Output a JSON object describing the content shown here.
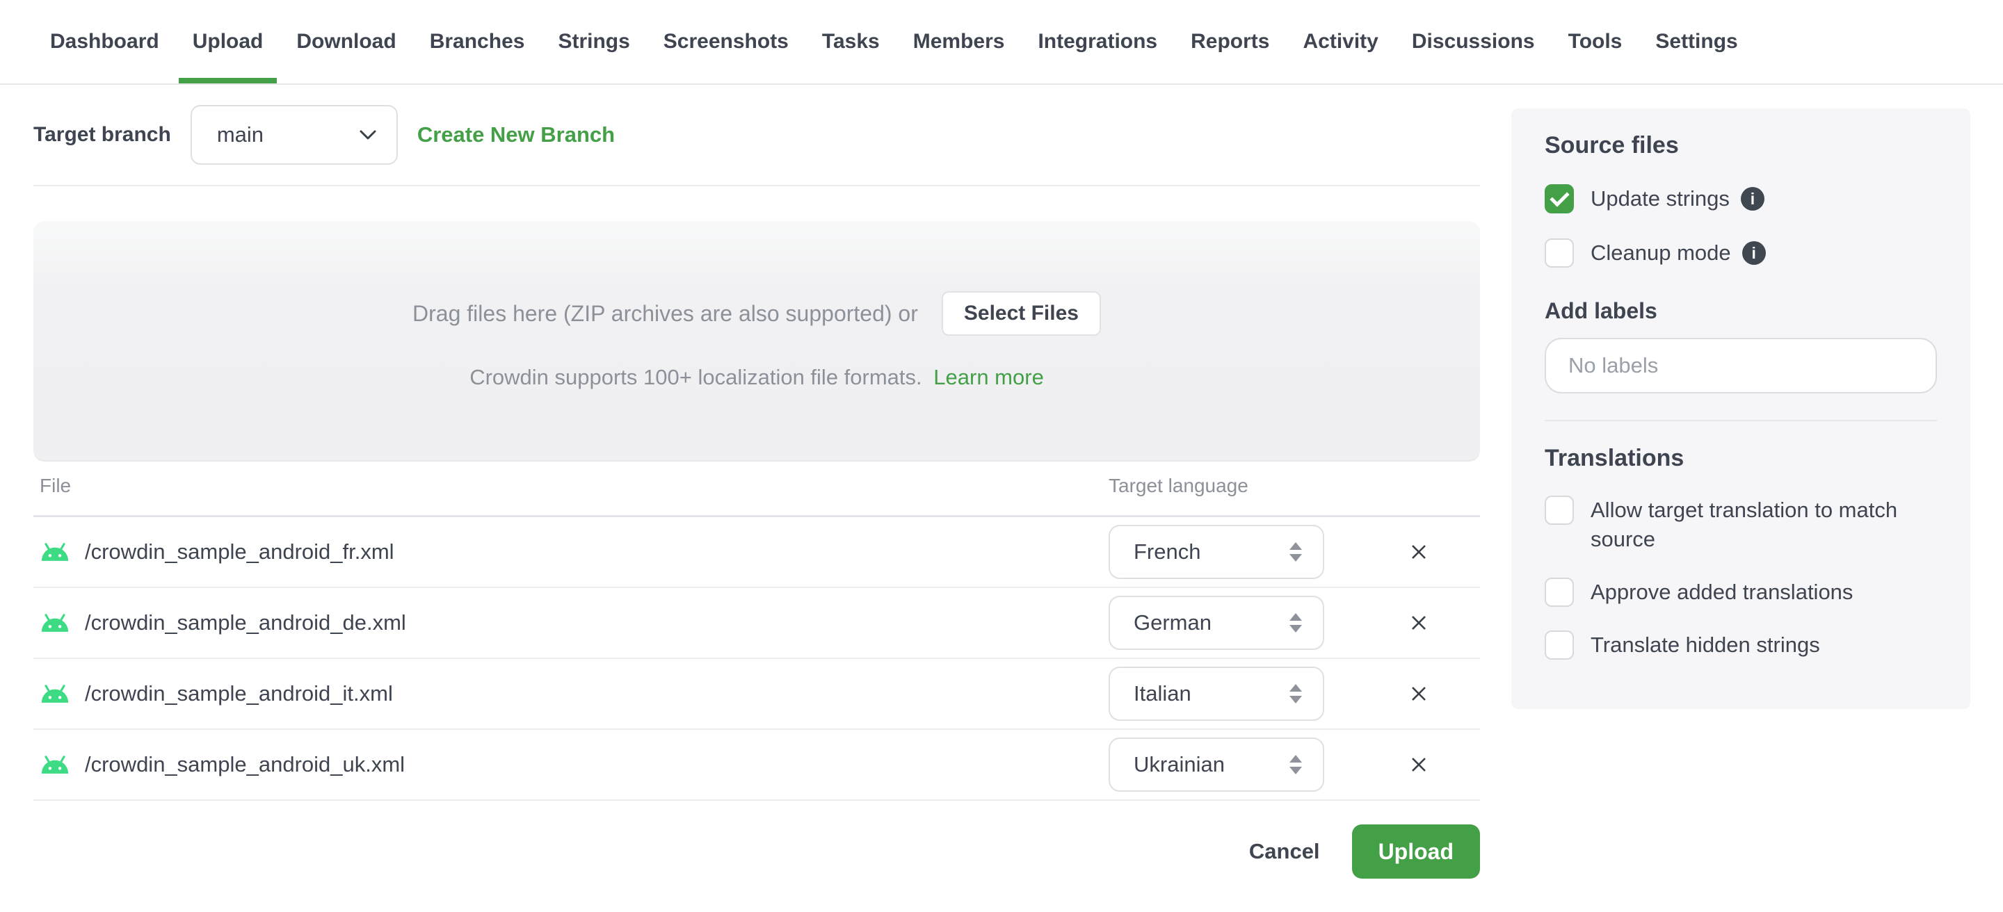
{
  "nav": {
    "items": [
      "Dashboard",
      "Upload",
      "Download",
      "Branches",
      "Strings",
      "Screenshots",
      "Tasks",
      "Members",
      "Integrations",
      "Reports",
      "Activity",
      "Discussions",
      "Tools",
      "Settings"
    ],
    "active": "Upload"
  },
  "branch_bar": {
    "label": "Target branch",
    "selected": "main",
    "create_link": "Create New Branch"
  },
  "dropzone": {
    "line1": "Drag files here (ZIP archives are also supported) or",
    "select_button": "Select Files",
    "support_text": "Crowdin supports 100+ localization file formats.",
    "learn_more": "Learn more"
  },
  "files_table": {
    "columns": [
      "File",
      "Target language"
    ],
    "rows": [
      {
        "file": "/crowdin_sample_android_fr.xml",
        "language": "French"
      },
      {
        "file": "/crowdin_sample_android_de.xml",
        "language": "German"
      },
      {
        "file": "/crowdin_sample_android_it.xml",
        "language": "Italian"
      },
      {
        "file": "/crowdin_sample_android_uk.xml",
        "language": "Ukrainian"
      }
    ]
  },
  "sidebar": {
    "source_files": {
      "title": "Source files",
      "options": [
        {
          "label": "Update strings",
          "checked": true,
          "info": true
        },
        {
          "label": "Cleanup mode",
          "checked": false,
          "info": true
        }
      ]
    },
    "labels": {
      "title": "Add labels",
      "placeholder": "No labels"
    },
    "translations": {
      "title": "Translations",
      "options": [
        {
          "label": "Allow target translation to match source",
          "checked": false
        },
        {
          "label": "Approve added translations",
          "checked": false
        },
        {
          "label": "Translate hidden strings",
          "checked": false
        }
      ]
    }
  },
  "footer": {
    "cancel_label": "Cancel",
    "upload_label": "Upload"
  },
  "icons": {
    "file_type": "android-icon",
    "remove": "close-icon",
    "branch_dropdown": "chevron-down-icon",
    "language_dropdown": "up-down-arrows-icon",
    "tooltip": "info-icon"
  },
  "colors": {
    "accent_green": "#43a047",
    "android_green": "#3ddc84",
    "text_primary": "#3e4450",
    "text_muted": "#8c9199",
    "panel_background": "#f6f6f8"
  }
}
